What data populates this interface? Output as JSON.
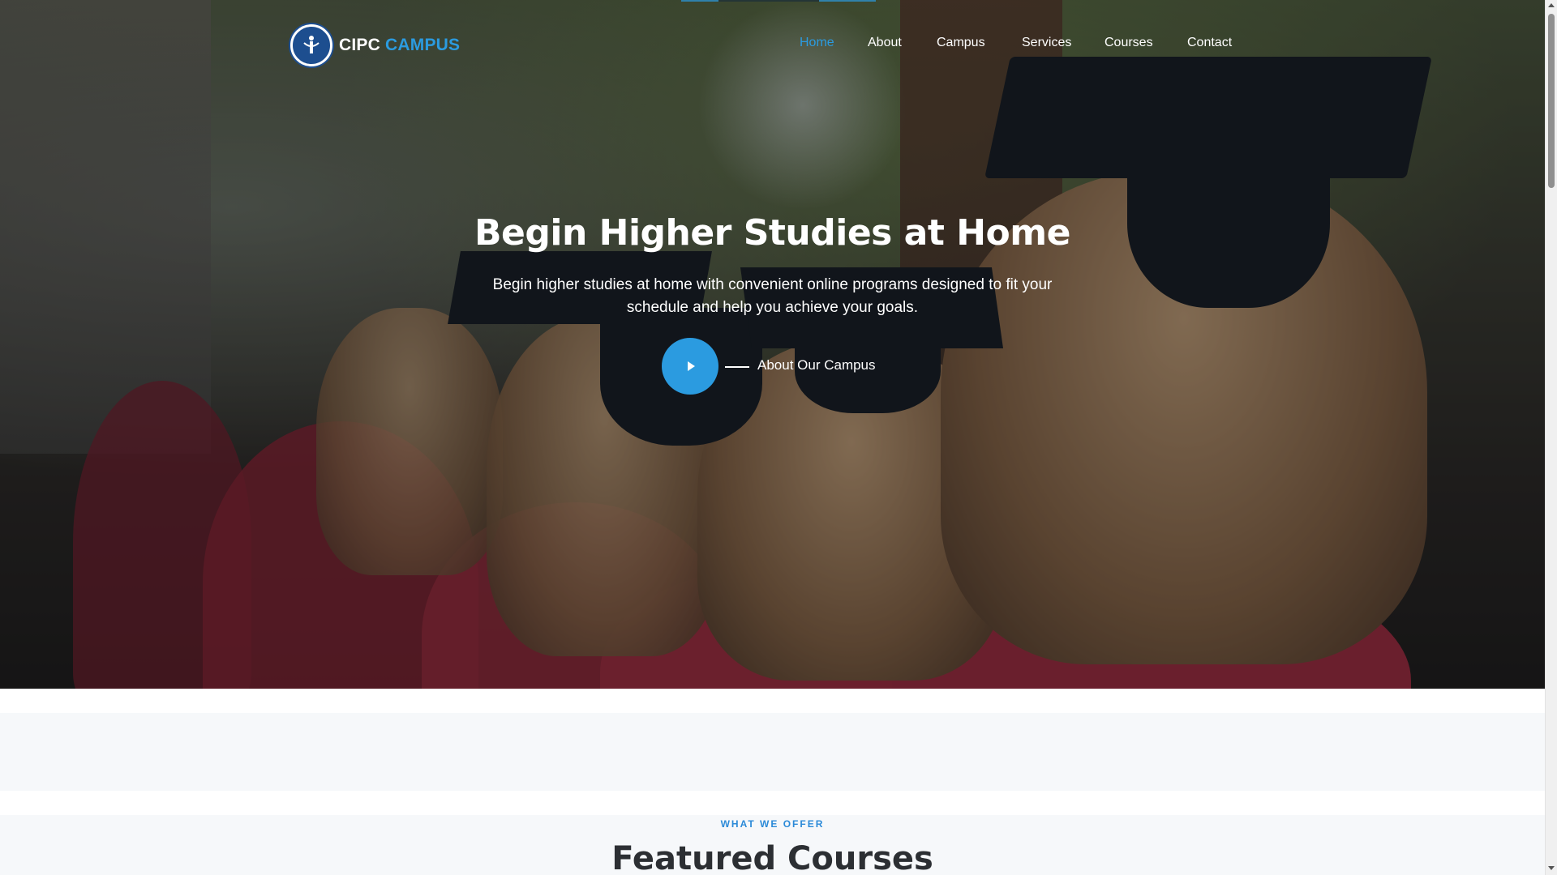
{
  "brand": {
    "name_part1": "CIPC",
    "name_part2": "CAMPUS",
    "logo_icon": "emblem-icon",
    "accent_color": "#2b9be0"
  },
  "nav": {
    "items": [
      {
        "label": "Home",
        "active": true
      },
      {
        "label": "About",
        "active": false
      },
      {
        "label": "Campus",
        "active": false
      },
      {
        "label": "Services",
        "active": false
      },
      {
        "label": "Courses",
        "active": false
      },
      {
        "label": "Contact",
        "active": false
      }
    ]
  },
  "hero": {
    "title": "Begin Higher Studies at Home",
    "subtitle": "Begin higher studies at home with convenient online programs designed to fit your schedule and help you achieve your goals.",
    "play_icon": "play-icon",
    "cta_label": "About Our Campus"
  },
  "featured": {
    "eyebrow": "WHAT WE OFFER",
    "title": "Featured Courses"
  }
}
